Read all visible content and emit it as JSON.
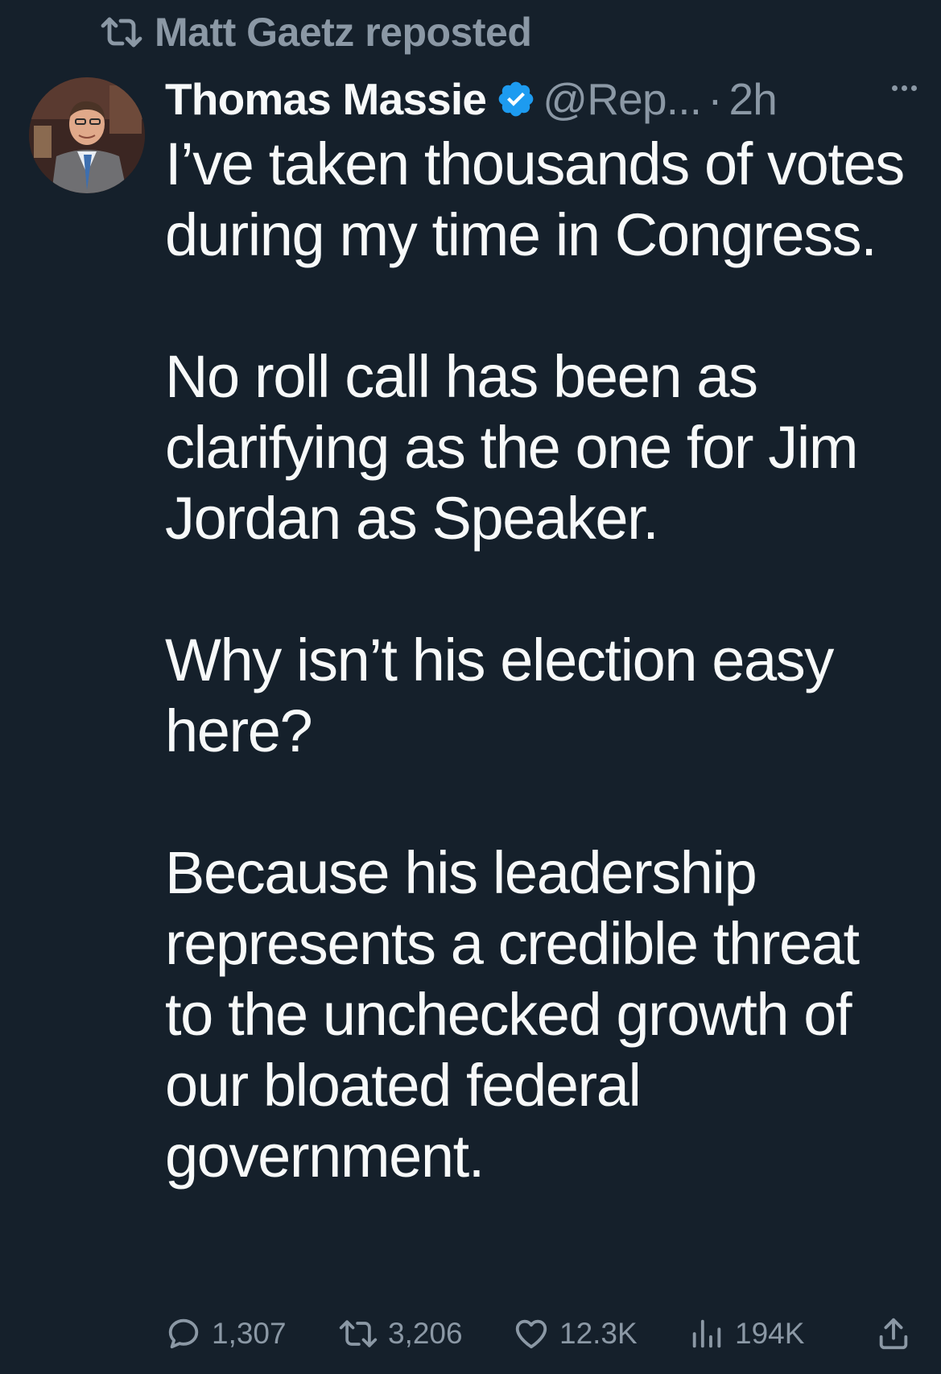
{
  "repost_banner": {
    "icon": "repost-icon",
    "text": "Matt Gaetz reposted"
  },
  "tweet": {
    "avatar_icon": "user-avatar",
    "display_name": "Thomas Massie",
    "verified_icon": "verified-badge-icon",
    "handle": "@Rep...",
    "separator": "·",
    "time": "2h",
    "more_icon": "more-options-icon",
    "paragraphs": [
      "I’ve taken thousands of votes during my time in Congress.",
      "No roll call has been as clarifying as the one for Jim Jordan as Speaker.",
      "Why isn’t his election easy here?",
      "Because his leadership represents a credible threat to the unchecked growth of our bloated federal government."
    ],
    "actions": {
      "replies": "1,307",
      "reposts": "3,206",
      "likes": "12.3K",
      "views": "194K",
      "share_icon": "share-icon"
    }
  },
  "colors": {
    "background": "#15202b",
    "primary_text": "#f7f9f9",
    "secondary_text": "#8b98a5",
    "verified_badge": "#1d9bf0"
  }
}
